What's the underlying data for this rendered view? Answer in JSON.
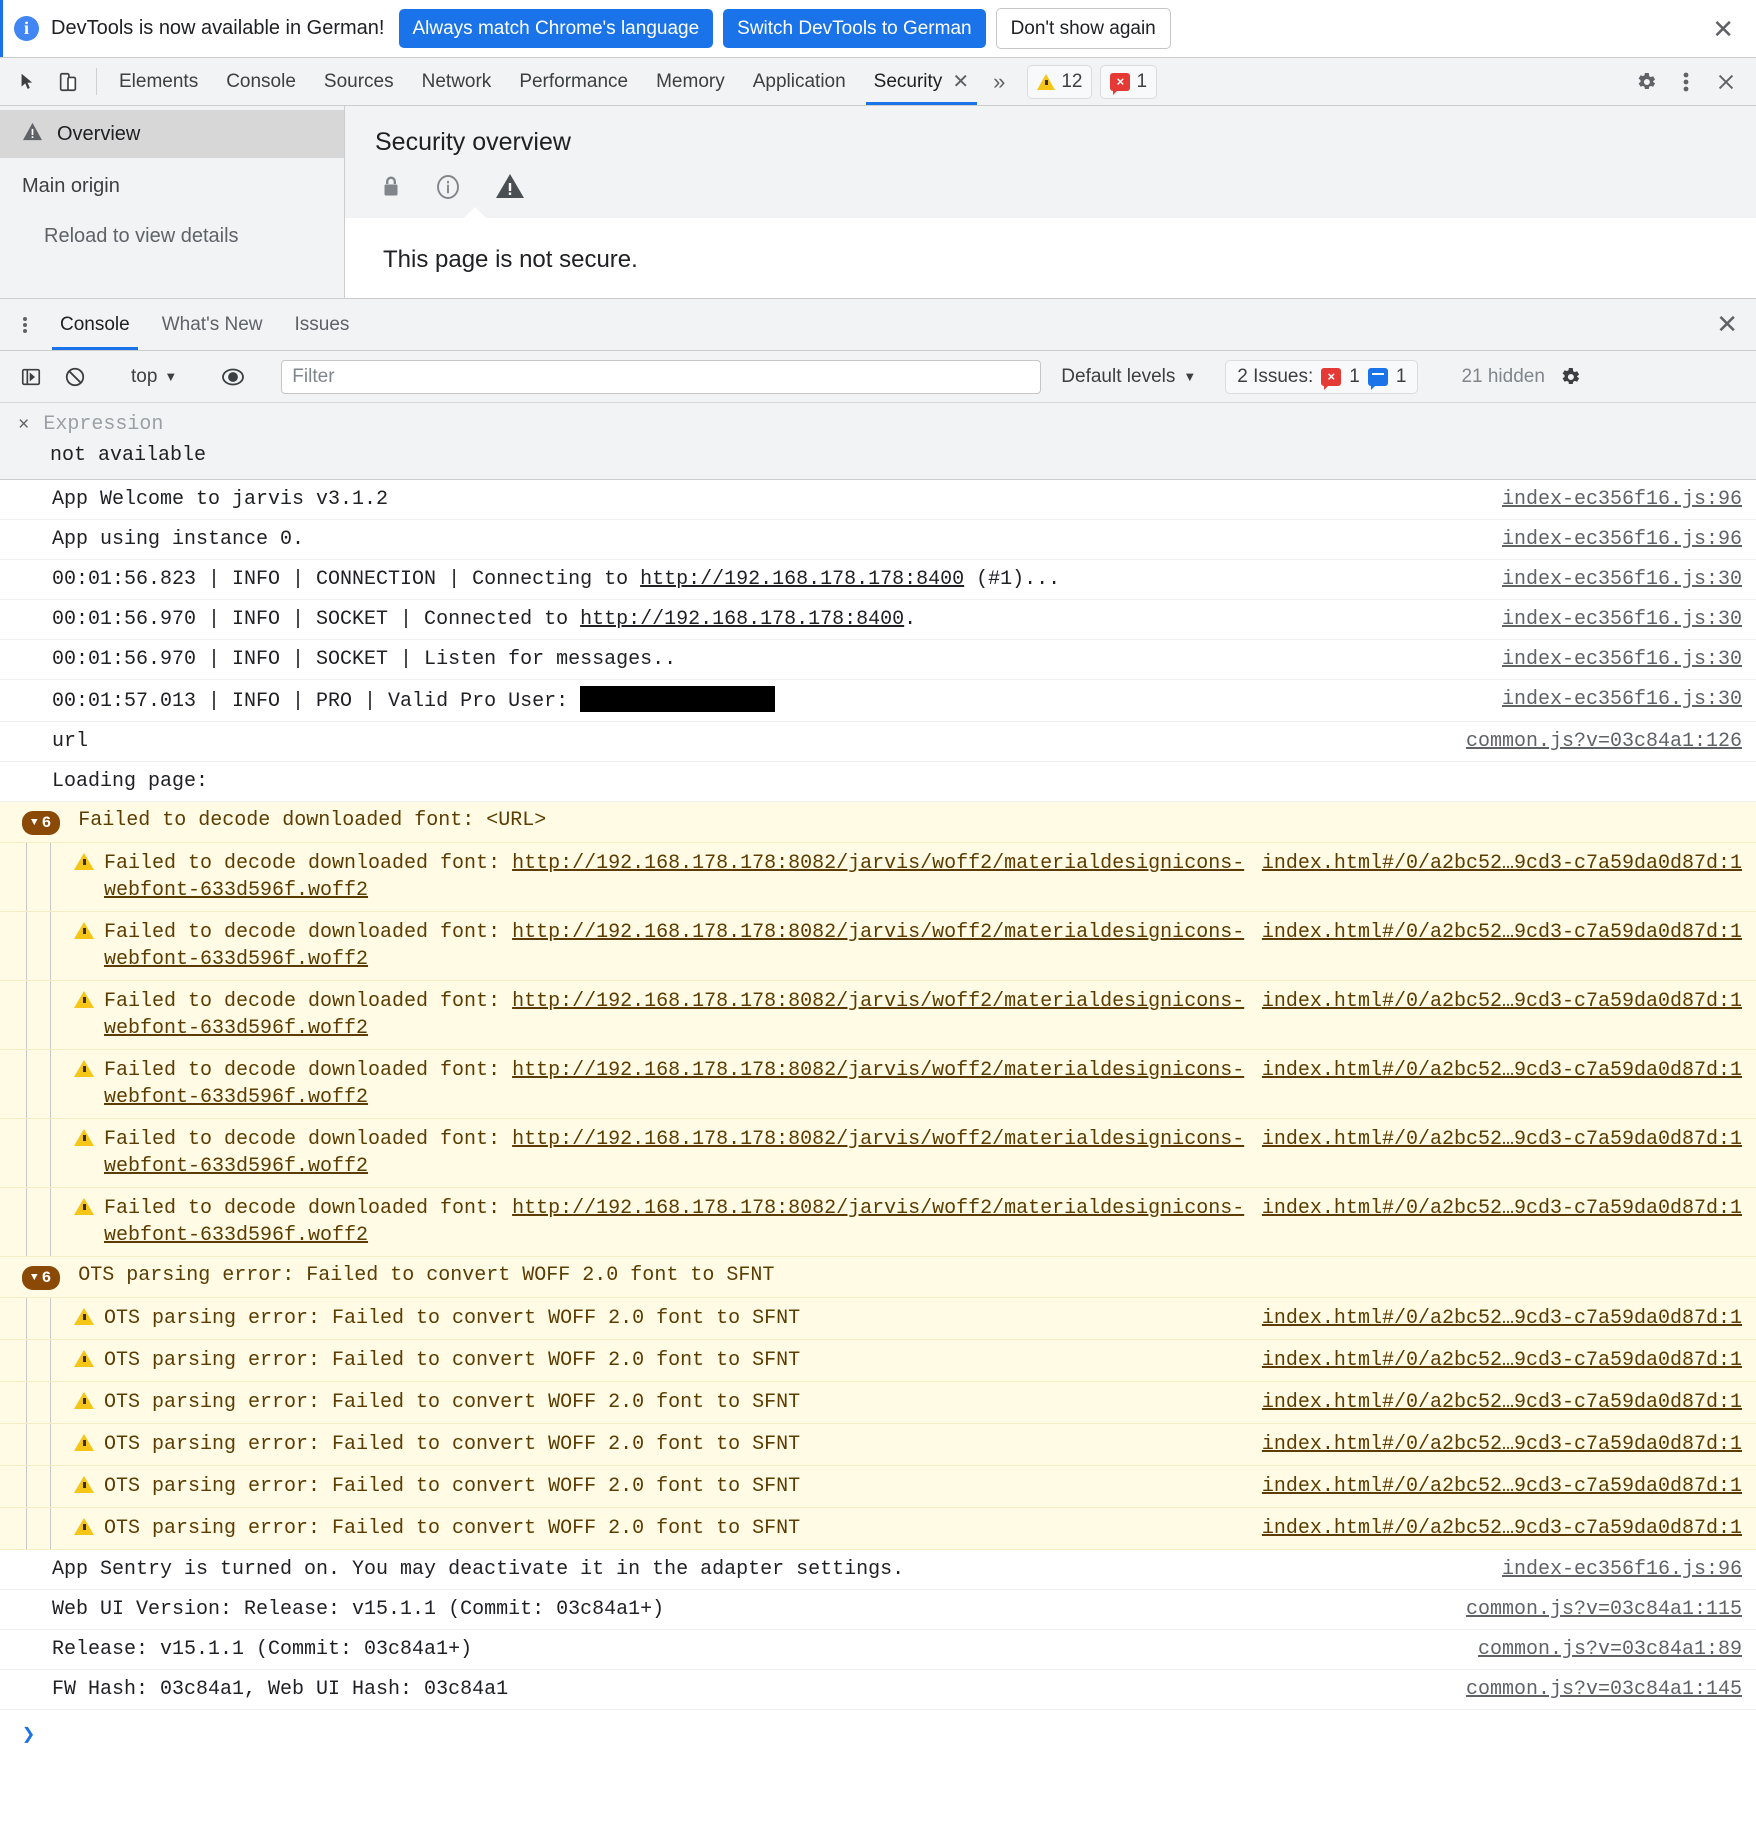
{
  "infobar": {
    "message": "DevTools is now available in German!",
    "btn_always": "Always match Chrome's language",
    "btn_switch": "Switch DevTools to German",
    "btn_dismiss": "Don't show again",
    "close": "✕",
    "icon": "info-icon"
  },
  "tabbar": {
    "tabs": [
      {
        "label": "Elements",
        "active": false
      },
      {
        "label": "Console",
        "active": false
      },
      {
        "label": "Sources",
        "active": false
      },
      {
        "label": "Network",
        "active": false
      },
      {
        "label": "Performance",
        "active": false
      },
      {
        "label": "Memory",
        "active": false
      },
      {
        "label": "Application",
        "active": false
      },
      {
        "label": "Security",
        "active": true
      }
    ],
    "active_tab_close": "✕",
    "more_tabs": "»",
    "warning_count": "12",
    "error_count": "1",
    "settings_icon": "gear-icon",
    "more_icon": "kebab-icon",
    "close_icon": "✕"
  },
  "security": {
    "sidebar": {
      "overview": "Overview",
      "group_title": "Main origin",
      "sub_item": "Reload to view details"
    },
    "title": "Security overview",
    "icons": [
      "lock-icon",
      "info-circle-icon",
      "warning-triangle-icon"
    ],
    "message": "This page is not secure."
  },
  "drawer": {
    "tabs": [
      {
        "label": "Console",
        "active": true
      },
      {
        "label": "What's New",
        "active": false
      },
      {
        "label": "Issues",
        "active": false
      }
    ],
    "close": "✕"
  },
  "console_toolbar": {
    "sidebar_toggle_icon": "show-console-sidebar-icon",
    "clear_icon": "clear-console-icon",
    "context": "top",
    "context_caret": "▼",
    "eye_icon": "live-expression-icon",
    "filter_placeholder": "Filter",
    "filter_value": "",
    "levels_label": "Default levels",
    "levels_caret": "▼",
    "issues_label": "2 Issues:",
    "issues_error_count": "1",
    "issues_info_count": "1",
    "hidden_label": "21 hidden",
    "settings_icon": "console-settings-gear-icon"
  },
  "live_expression": {
    "close": "×",
    "placeholder": "Expression",
    "value": "not available"
  },
  "console_log": {
    "rows": [
      {
        "kind": "log",
        "text": "App Welcome to jarvis v3.1.2",
        "src": "index-ec356f16.js:96"
      },
      {
        "kind": "log",
        "text": "App using instance 0.",
        "src": "index-ec356f16.js:96"
      },
      {
        "kind": "log-link",
        "pre": "00:01:56.823 | INFO | CONNECTION | Connecting to ",
        "link": "http://192.168.178.178:8400",
        "post": " (#1)...",
        "src": "index-ec356f16.js:30"
      },
      {
        "kind": "log-link",
        "pre": "00:01:56.970 | INFO | SOCKET | Connected to ",
        "link": "http://192.168.178.178:8400",
        "post": ".",
        "src": "index-ec356f16.js:30"
      },
      {
        "kind": "log",
        "text": "00:01:56.970 | INFO | SOCKET | Listen for messages..",
        "src": "index-ec356f16.js:30"
      },
      {
        "kind": "log-redacted",
        "pre": "00:01:57.013 | INFO | PRO | Valid Pro User: ",
        "src": "index-ec356f16.js:30"
      },
      {
        "kind": "log",
        "text": "url",
        "src": "common.js?v=03c84a1:126"
      },
      {
        "kind": "log",
        "text": "Loading page:",
        "src": ""
      }
    ],
    "group_font": {
      "badge_count": "6",
      "badge_caret": "▼",
      "header": "Failed to decode downloaded font: <URL>",
      "item_prefix": "Failed to decode downloaded font: ",
      "item_url": "http://192.168.178.178:8082/jarvis/woff2/materialdesignicons-webfont-633d596f.woff2",
      "item_src": "index.html#/0/a2bc52…9cd3-c7a59da0d87d:1",
      "repeat": 6
    },
    "group_ots": {
      "badge_count": "6",
      "badge_caret": "▼",
      "header": "OTS parsing error: Failed to convert WOFF 2.0 font to SFNT",
      "item_text": "OTS parsing error: Failed to convert WOFF 2.0 font to SFNT",
      "item_src": "index.html#/0/a2bc52…9cd3-c7a59da0d87d:1",
      "repeat": 6
    },
    "tail_rows": [
      {
        "kind": "log",
        "text": "App Sentry is turned on. You may deactivate it in the adapter settings.",
        "src": "index-ec356f16.js:96"
      },
      {
        "kind": "log",
        "text": "Web UI Version: Release: v15.1.1 (Commit: 03c84a1+)",
        "src": "common.js?v=03c84a1:115"
      },
      {
        "kind": "log",
        "text": "Release: v15.1.1 (Commit: 03c84a1+)",
        "src": "common.js?v=03c84a1:89"
      },
      {
        "kind": "log",
        "text": "FW Hash: 03c84a1, Web UI Hash: 03c84a1",
        "src": "common.js?v=03c84a1:145"
      }
    ],
    "prompt": "❯"
  },
  "colors": {
    "accent": "#1a73e8",
    "warning_bg": "#fffbe5",
    "warning_text": "#5c3c00",
    "error_red": "#e53935",
    "warning_yellow": "#f5c518",
    "group_badge": "#8a4a06"
  }
}
